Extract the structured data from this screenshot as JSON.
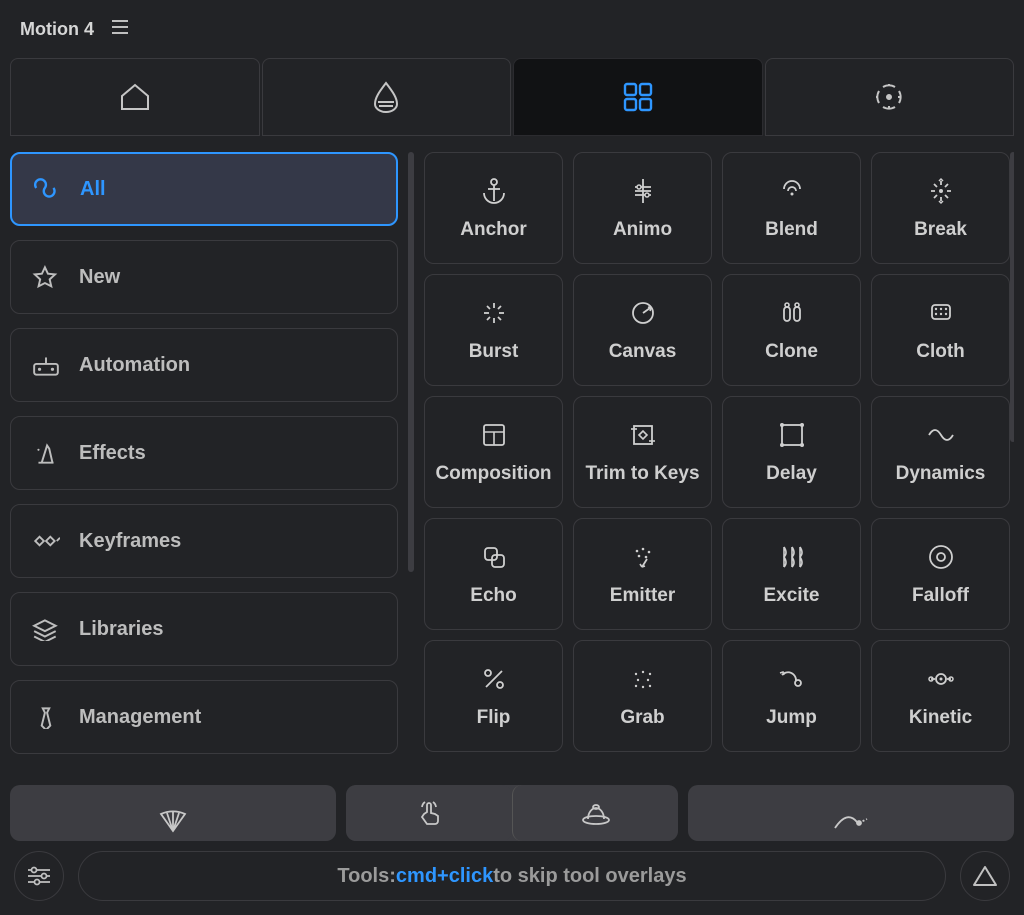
{
  "header": {
    "title": "Motion 4"
  },
  "sidebar": {
    "items": [
      {
        "label": "All",
        "icon": "infinity",
        "active": true
      },
      {
        "label": "New",
        "icon": "star"
      },
      {
        "label": "Automation",
        "icon": "controller"
      },
      {
        "label": "Effects",
        "icon": "wizard-hat"
      },
      {
        "label": "Keyframes",
        "icon": "keyframes"
      },
      {
        "label": "Libraries",
        "icon": "stack"
      },
      {
        "label": "Management",
        "icon": "tie"
      }
    ]
  },
  "tools": [
    {
      "label": "Anchor",
      "icon": "anchor"
    },
    {
      "label": "Animo",
      "icon": "animo"
    },
    {
      "label": "Blend",
      "icon": "blend"
    },
    {
      "label": "Break",
      "icon": "break"
    },
    {
      "label": "Burst",
      "icon": "burst"
    },
    {
      "label": "Canvas",
      "icon": "canvas"
    },
    {
      "label": "Clone",
      "icon": "clone"
    },
    {
      "label": "Cloth",
      "icon": "cloth"
    },
    {
      "label": "Composition",
      "icon": "composition"
    },
    {
      "label": "Trim to Keys",
      "icon": "trim"
    },
    {
      "label": "Delay",
      "icon": "delay"
    },
    {
      "label": "Dynamics",
      "icon": "dynamics"
    },
    {
      "label": "Echo",
      "icon": "echo"
    },
    {
      "label": "Emitter",
      "icon": "emitter"
    },
    {
      "label": "Excite",
      "icon": "excite"
    },
    {
      "label": "Falloff",
      "icon": "falloff"
    },
    {
      "label": "Flip",
      "icon": "flip"
    },
    {
      "label": "Grab",
      "icon": "grab"
    },
    {
      "label": "Jump",
      "icon": "jump"
    },
    {
      "label": "Kinetic",
      "icon": "kinetic"
    }
  ],
  "hint": {
    "prefix": "Tools: ",
    "accent": "cmd+click",
    "suffix": " to skip tool overlays"
  }
}
